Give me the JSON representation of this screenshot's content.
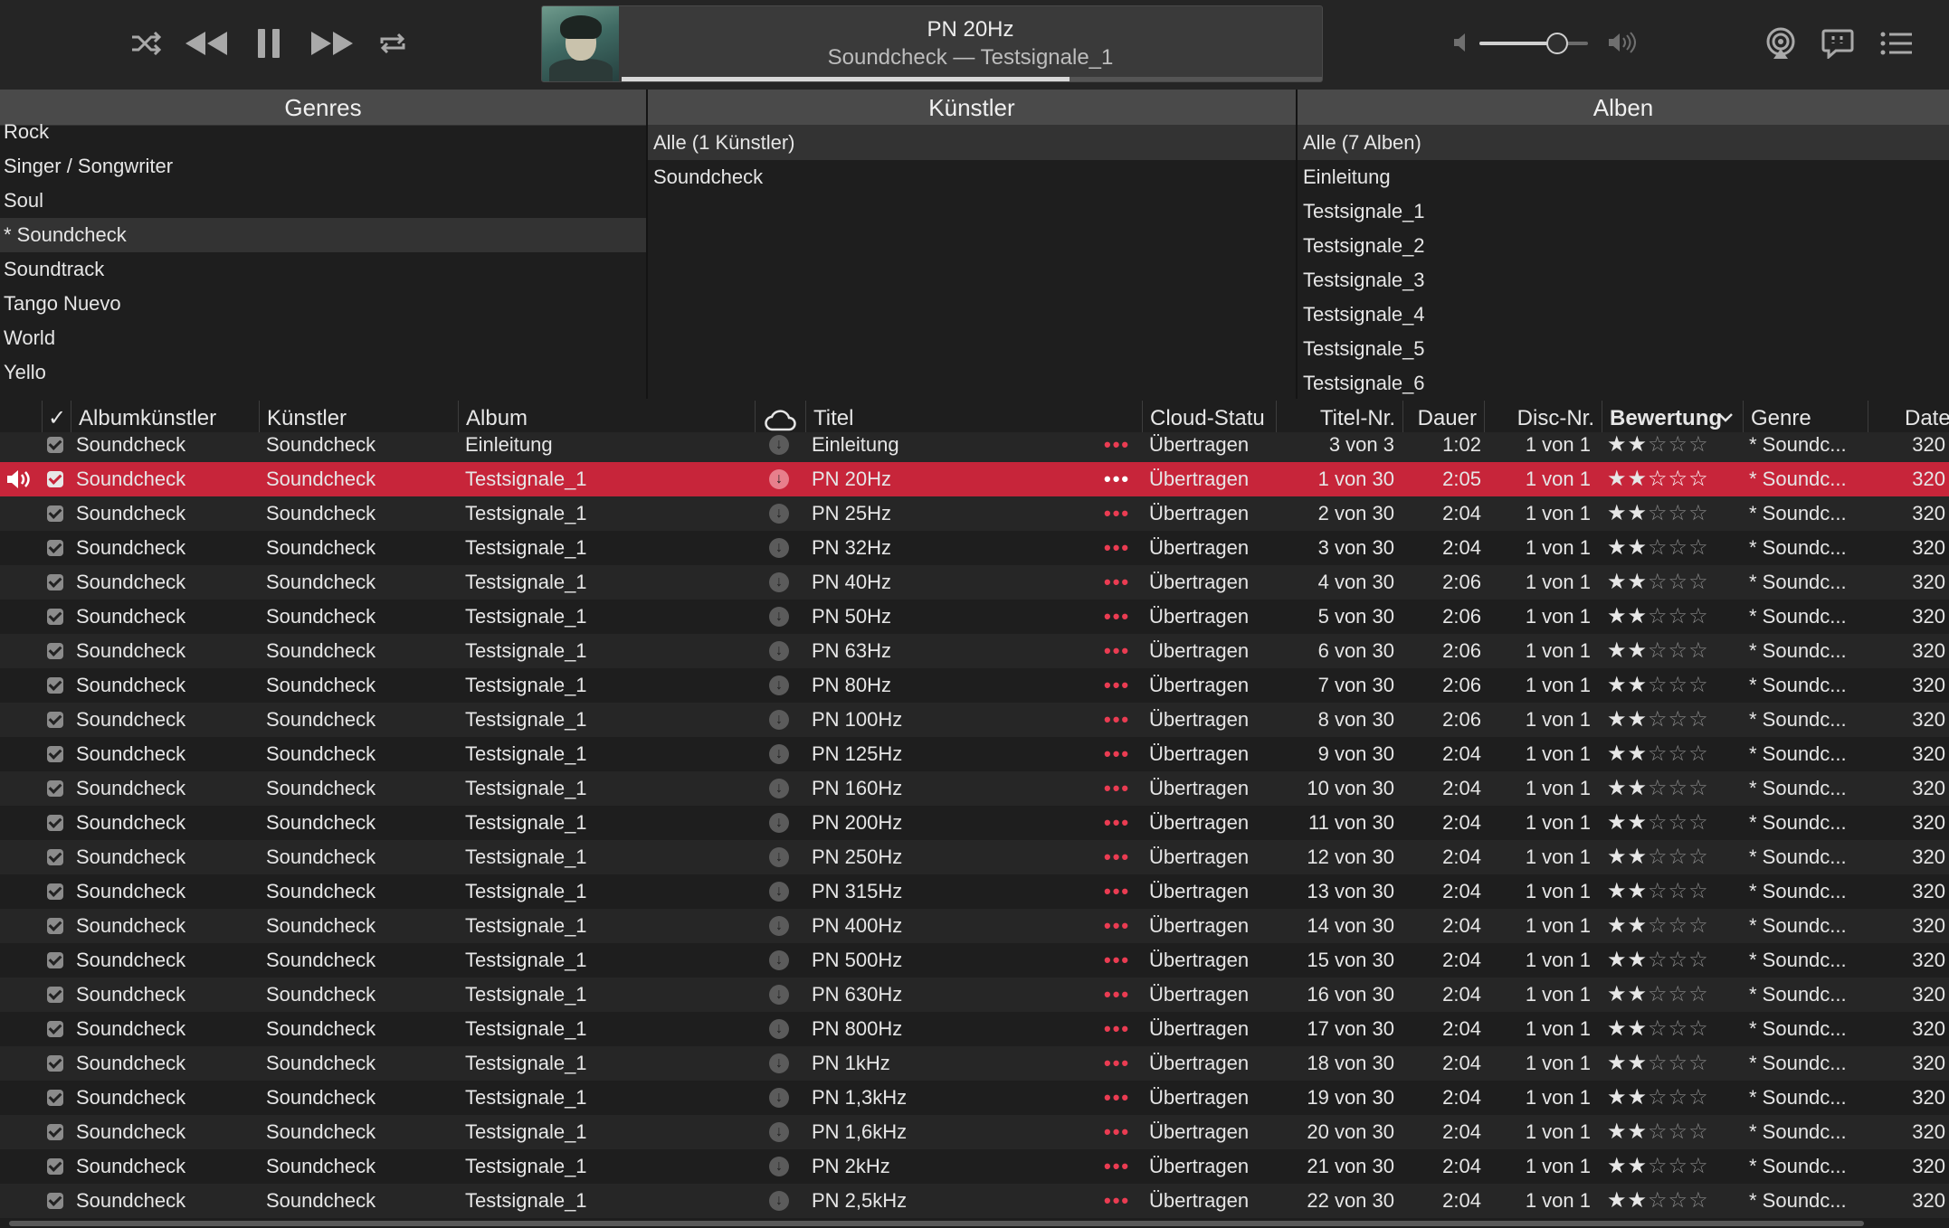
{
  "player": {
    "track_title": "PN 20Hz",
    "track_subtitle": "Soundcheck — Testsignale_1",
    "progress": 0.64,
    "volume": 0.72
  },
  "panes": {
    "genres": {
      "header": "Genres",
      "items": [
        "Rock",
        "Singer / Songwriter",
        "Soul",
        "* Soundcheck",
        "Soundtrack",
        "Tango Nuevo",
        "World",
        "Yello"
      ],
      "selected_index": 3
    },
    "artists": {
      "header": "Künstler",
      "items": [
        "Alle (1 Künstler)",
        "Soundcheck"
      ],
      "selected_index": 0
    },
    "albums": {
      "header": "Alben",
      "items": [
        "Alle (7 Alben)",
        "Einleitung",
        "Testsignale_1",
        "Testsignale_2",
        "Testsignale_3",
        "Testsignale_4",
        "Testsignale_5",
        "Testsignale_6"
      ],
      "selected_index": 0
    }
  },
  "table": {
    "columns": {
      "check": "✓",
      "album_artist": "Albumkünstler",
      "artist": "Künstler",
      "album": "Album",
      "title": "Titel",
      "cloud_status": "Cloud-Statu",
      "track_no": "Titel-Nr.",
      "duration": "Dauer",
      "disc_no": "Disc-Nr.",
      "rating": "Bewertung",
      "genre": "Genre",
      "date": "Date"
    },
    "rows": [
      {
        "album_artist": "Soundcheck",
        "artist": "Soundcheck",
        "album": "Einleitung",
        "title": "Einleitung",
        "cloud": "Übertragen",
        "track_no": "3 von 3",
        "duration": "1:02",
        "disc": "1 von 1",
        "rating": 2,
        "genre": "* Soundc...",
        "date": "320",
        "playing": false
      },
      {
        "album_artist": "Soundcheck",
        "artist": "Soundcheck",
        "album": "Testsignale_1",
        "title": "PN 20Hz",
        "cloud": "Übertragen",
        "track_no": "1 von 30",
        "duration": "2:05",
        "disc": "1 von 1",
        "rating": 2,
        "genre": "* Soundc...",
        "date": "320",
        "playing": true
      },
      {
        "album_artist": "Soundcheck",
        "artist": "Soundcheck",
        "album": "Testsignale_1",
        "title": "PN 25Hz",
        "cloud": "Übertragen",
        "track_no": "2 von 30",
        "duration": "2:04",
        "disc": "1 von 1",
        "rating": 2,
        "genre": "* Soundc...",
        "date": "320",
        "playing": false
      },
      {
        "album_artist": "Soundcheck",
        "artist": "Soundcheck",
        "album": "Testsignale_1",
        "title": "PN 32Hz",
        "cloud": "Übertragen",
        "track_no": "3 von 30",
        "duration": "2:04",
        "disc": "1 von 1",
        "rating": 2,
        "genre": "* Soundc...",
        "date": "320",
        "playing": false
      },
      {
        "album_artist": "Soundcheck",
        "artist": "Soundcheck",
        "album": "Testsignale_1",
        "title": "PN 40Hz",
        "cloud": "Übertragen",
        "track_no": "4 von 30",
        "duration": "2:06",
        "disc": "1 von 1",
        "rating": 2,
        "genre": "* Soundc...",
        "date": "320",
        "playing": false
      },
      {
        "album_artist": "Soundcheck",
        "artist": "Soundcheck",
        "album": "Testsignale_1",
        "title": "PN 50Hz",
        "cloud": "Übertragen",
        "track_no": "5 von 30",
        "duration": "2:06",
        "disc": "1 von 1",
        "rating": 2,
        "genre": "* Soundc...",
        "date": "320",
        "playing": false
      },
      {
        "album_artist": "Soundcheck",
        "artist": "Soundcheck",
        "album": "Testsignale_1",
        "title": "PN 63Hz",
        "cloud": "Übertragen",
        "track_no": "6 von 30",
        "duration": "2:06",
        "disc": "1 von 1",
        "rating": 2,
        "genre": "* Soundc...",
        "date": "320",
        "playing": false
      },
      {
        "album_artist": "Soundcheck",
        "artist": "Soundcheck",
        "album": "Testsignale_1",
        "title": "PN 80Hz",
        "cloud": "Übertragen",
        "track_no": "7 von 30",
        "duration": "2:06",
        "disc": "1 von 1",
        "rating": 2,
        "genre": "* Soundc...",
        "date": "320",
        "playing": false
      },
      {
        "album_artist": "Soundcheck",
        "artist": "Soundcheck",
        "album": "Testsignale_1",
        "title": "PN 100Hz",
        "cloud": "Übertragen",
        "track_no": "8 von 30",
        "duration": "2:06",
        "disc": "1 von 1",
        "rating": 2,
        "genre": "* Soundc...",
        "date": "320",
        "playing": false
      },
      {
        "album_artist": "Soundcheck",
        "artist": "Soundcheck",
        "album": "Testsignale_1",
        "title": "PN 125Hz",
        "cloud": "Übertragen",
        "track_no": "9 von 30",
        "duration": "2:04",
        "disc": "1 von 1",
        "rating": 2,
        "genre": "* Soundc...",
        "date": "320",
        "playing": false
      },
      {
        "album_artist": "Soundcheck",
        "artist": "Soundcheck",
        "album": "Testsignale_1",
        "title": "PN 160Hz",
        "cloud": "Übertragen",
        "track_no": "10 von 30",
        "duration": "2:04",
        "disc": "1 von 1",
        "rating": 2,
        "genre": "* Soundc...",
        "date": "320",
        "playing": false
      },
      {
        "album_artist": "Soundcheck",
        "artist": "Soundcheck",
        "album": "Testsignale_1",
        "title": "PN 200Hz",
        "cloud": "Übertragen",
        "track_no": "11 von 30",
        "duration": "2:04",
        "disc": "1 von 1",
        "rating": 2,
        "genre": "* Soundc...",
        "date": "320",
        "playing": false
      },
      {
        "album_artist": "Soundcheck",
        "artist": "Soundcheck",
        "album": "Testsignale_1",
        "title": "PN 250Hz",
        "cloud": "Übertragen",
        "track_no": "12 von 30",
        "duration": "2:04",
        "disc": "1 von 1",
        "rating": 2,
        "genre": "* Soundc...",
        "date": "320",
        "playing": false
      },
      {
        "album_artist": "Soundcheck",
        "artist": "Soundcheck",
        "album": "Testsignale_1",
        "title": "PN 315Hz",
        "cloud": "Übertragen",
        "track_no": "13 von 30",
        "duration": "2:04",
        "disc": "1 von 1",
        "rating": 2,
        "genre": "* Soundc...",
        "date": "320",
        "playing": false
      },
      {
        "album_artist": "Soundcheck",
        "artist": "Soundcheck",
        "album": "Testsignale_1",
        "title": "PN 400Hz",
        "cloud": "Übertragen",
        "track_no": "14 von 30",
        "duration": "2:04",
        "disc": "1 von 1",
        "rating": 2,
        "genre": "* Soundc...",
        "date": "320",
        "playing": false
      },
      {
        "album_artist": "Soundcheck",
        "artist": "Soundcheck",
        "album": "Testsignale_1",
        "title": "PN 500Hz",
        "cloud": "Übertragen",
        "track_no": "15 von 30",
        "duration": "2:04",
        "disc": "1 von 1",
        "rating": 2,
        "genre": "* Soundc...",
        "date": "320",
        "playing": false
      },
      {
        "album_artist": "Soundcheck",
        "artist": "Soundcheck",
        "album": "Testsignale_1",
        "title": "PN 630Hz",
        "cloud": "Übertragen",
        "track_no": "16 von 30",
        "duration": "2:04",
        "disc": "1 von 1",
        "rating": 2,
        "genre": "* Soundc...",
        "date": "320",
        "playing": false
      },
      {
        "album_artist": "Soundcheck",
        "artist": "Soundcheck",
        "album": "Testsignale_1",
        "title": "PN 800Hz",
        "cloud": "Übertragen",
        "track_no": "17 von 30",
        "duration": "2:04",
        "disc": "1 von 1",
        "rating": 2,
        "genre": "* Soundc...",
        "date": "320",
        "playing": false
      },
      {
        "album_artist": "Soundcheck",
        "artist": "Soundcheck",
        "album": "Testsignale_1",
        "title": "PN 1kHz",
        "cloud": "Übertragen",
        "track_no": "18 von 30",
        "duration": "2:04",
        "disc": "1 von 1",
        "rating": 2,
        "genre": "* Soundc...",
        "date": "320",
        "playing": false
      },
      {
        "album_artist": "Soundcheck",
        "artist": "Soundcheck",
        "album": "Testsignale_1",
        "title": "PN 1,3kHz",
        "cloud": "Übertragen",
        "track_no": "19 von 30",
        "duration": "2:04",
        "disc": "1 von 1",
        "rating": 2,
        "genre": "* Soundc...",
        "date": "320",
        "playing": false
      },
      {
        "album_artist": "Soundcheck",
        "artist": "Soundcheck",
        "album": "Testsignale_1",
        "title": "PN 1,6kHz",
        "cloud": "Übertragen",
        "track_no": "20 von 30",
        "duration": "2:04",
        "disc": "1 von 1",
        "rating": 2,
        "genre": "* Soundc...",
        "date": "320",
        "playing": false
      },
      {
        "album_artist": "Soundcheck",
        "artist": "Soundcheck",
        "album": "Testsignale_1",
        "title": "PN 2kHz",
        "cloud": "Übertragen",
        "track_no": "21 von 30",
        "duration": "2:04",
        "disc": "1 von 1",
        "rating": 2,
        "genre": "* Soundc...",
        "date": "320",
        "playing": false
      },
      {
        "album_artist": "Soundcheck",
        "artist": "Soundcheck",
        "album": "Testsignale_1",
        "title": "PN 2,5kHz",
        "cloud": "Übertragen",
        "track_no": "22 von 30",
        "duration": "2:04",
        "disc": "1 von 1",
        "rating": 2,
        "genre": "* Soundc...",
        "date": "320",
        "playing": false
      }
    ]
  }
}
